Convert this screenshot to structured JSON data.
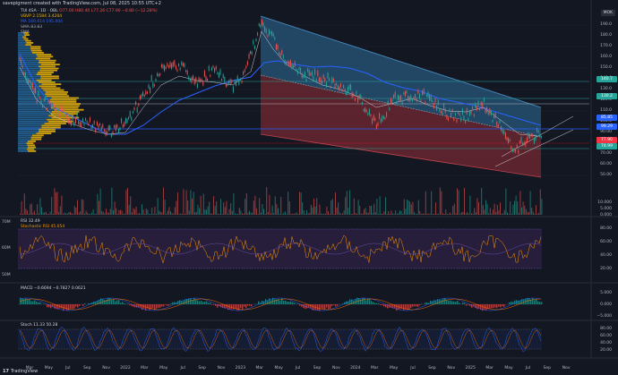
{
  "header": {
    "text": "savepigment created with TradingView.com, Jul 08, 2025 10:55 UTC+2"
  },
  "legend": {
    "symbol": "TUI 4SA · 1D · OBL",
    "ohlc": "O77.00 H80.40 L77.26 C77.90 −0.80 (−12.28%)",
    "vbvp": "VBVP 2.1584 3.4204",
    "ma": "MA 160.614 195.004",
    "smA": "SMA 83.83",
    "smB": "SMA"
  },
  "timeframe_button": "MOK",
  "price_axis": [
    "190.0",
    "180.0",
    "170.0",
    "160.0",
    "150.0",
    "140.0",
    "130.0",
    "120.0",
    "110.0",
    "100.0",
    "90.00",
    "80.00",
    "70.00",
    "60.00",
    "50.00"
  ],
  "price_tags": [
    {
      "label": "140.7",
      "color": "#26a69a"
    },
    {
      "label": "130.2",
      "color": "#26a69a"
    },
    {
      "label": "99.29",
      "color": "#2962ff"
    },
    {
      "label": "85.85",
      "color": "#2962ff"
    },
    {
      "label": "77.90",
      "color": "#f23645"
    },
    {
      "label": "74.99",
      "color": "#26a69a"
    }
  ],
  "volume_axis": [
    "10.000",
    "5.000",
    "0.000"
  ],
  "rsi": {
    "title": "RSI 32.49",
    "subtitle": "Stochastic RSI 45.054",
    "axis": [
      "80.00",
      "60.00",
      "40.00",
      "20.00"
    ],
    "left": [
      "70M",
      "60M",
      "50M"
    ]
  },
  "macd": {
    "title": "MACD −0.6694 −0.7827 0.0621",
    "axis": [
      "5.000",
      "0.000",
      "−5.000"
    ]
  },
  "stoch": {
    "title": "Stoch 11.33 50.28",
    "axis": [
      "80.00",
      "60.00",
      "40.00",
      "20.00"
    ]
  },
  "time_axis": [
    "Mar",
    "May",
    "Jul",
    "Sep",
    "Nov",
    "2022",
    "Mar",
    "May",
    "Jul",
    "Sep",
    "Nov",
    "2023",
    "Mar",
    "May",
    "Jul",
    "Sep",
    "Nov",
    "2024",
    "Mar",
    "May",
    "Jul",
    "Sep",
    "Nov",
    "2025",
    "Mar",
    "May",
    "Jul",
    "Sep",
    "Nov"
  ],
  "brand": "TradingView",
  "colors": {
    "background": "#131722",
    "up": "#26a69a",
    "down": "#ef5350",
    "ma_blue": "#2962ff",
    "profile": "#f0b90b",
    "channel_blue": "#2f6f9a",
    "channel_red": "#8a2c35"
  }
}
